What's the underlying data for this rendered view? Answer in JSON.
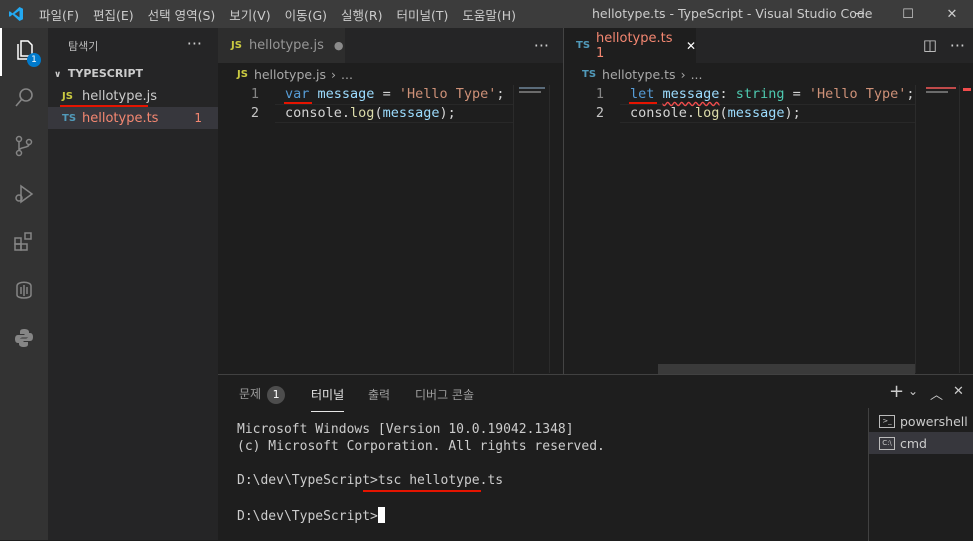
{
  "titlebar": {
    "menu": [
      "파일(F)",
      "편집(E)",
      "선택 영역(S)",
      "보기(V)",
      "이동(G)",
      "실행(R)",
      "터미널(T)",
      "도움말(H)"
    ],
    "title": "hellotype.ts - TypeScript - Visual Studio Code",
    "minimize": "─",
    "maximize": "☐",
    "close": "✕"
  },
  "activity": {
    "explorer_badge": "1"
  },
  "sidebar": {
    "header": "탐색기",
    "more": "···",
    "section": "TYPESCRIPT",
    "files": [
      {
        "icon": "JS",
        "name": "hellotype.js",
        "icon_color": "#cbcb41",
        "name_color": "#cccccc"
      },
      {
        "icon": "TS",
        "name": "hellotype.ts",
        "icon_color": "#519aba",
        "name_color": "#f48771",
        "count": "1"
      }
    ]
  },
  "editor_left": {
    "tab_icon": "JS",
    "tab_label": "hellotype.js",
    "tab_dirty": "●",
    "more": "···",
    "breadcrumb_icon": "JS",
    "breadcrumb": "hellotype.js",
    "breadcrumb_sep": "›",
    "breadcrumb_more": "...",
    "lines": [
      "1",
      "2"
    ],
    "code": {
      "l1_kw": "var",
      "l1_var": "message",
      "l1_eq": " = ",
      "l1_str": "'Hello Type'",
      "l1_end": ";",
      "l2_obj": "console",
      "l2_dot": ".",
      "l2_fn": "log",
      "l2_open": "(",
      "l2_arg": "message",
      "l2_close": ");"
    }
  },
  "editor_right": {
    "tab_icon": "TS",
    "tab_label": "hellotype.ts 1",
    "tab_close": "✕",
    "split": "◫",
    "more": "···",
    "breadcrumb_icon": "TS",
    "breadcrumb": "hellotype.ts",
    "breadcrumb_sep": "›",
    "breadcrumb_more": "...",
    "lines": [
      "1",
      "2"
    ],
    "code": {
      "l1_kw": "let",
      "l1_var": "message",
      "l1_colon": ": ",
      "l1_type": "string",
      "l1_eq": " = ",
      "l1_str": "'Hello Type'",
      "l1_end": ";",
      "l2_obj": "console",
      "l2_dot": ".",
      "l2_fn": "log",
      "l2_open": "(",
      "l2_arg": "message",
      "l2_close": ");"
    }
  },
  "panel": {
    "tabs": {
      "problems": "문제",
      "problems_count": "1",
      "terminal": "터미널",
      "output": "출력",
      "debug": "디버그 콘솔"
    },
    "actions": {
      "add": "+",
      "dropdown": "⌄",
      "maximize": "︿",
      "close": "✕"
    },
    "terminal_lines": {
      "l1": "Microsoft Windows [Version 10.0.19042.1348]",
      "l2": "(c) Microsoft Corporation. All rights reserved.",
      "l3_prompt": "D:\\dev\\TypeScript>",
      "l3_cmd": "tsc hellotype.ts",
      "l4_prompt": "D:\\dev\\TypeScript>"
    },
    "terminals": [
      {
        "icon": ">_",
        "label": "powershell"
      },
      {
        "icon": "C:\\",
        "label": "cmd"
      }
    ]
  }
}
